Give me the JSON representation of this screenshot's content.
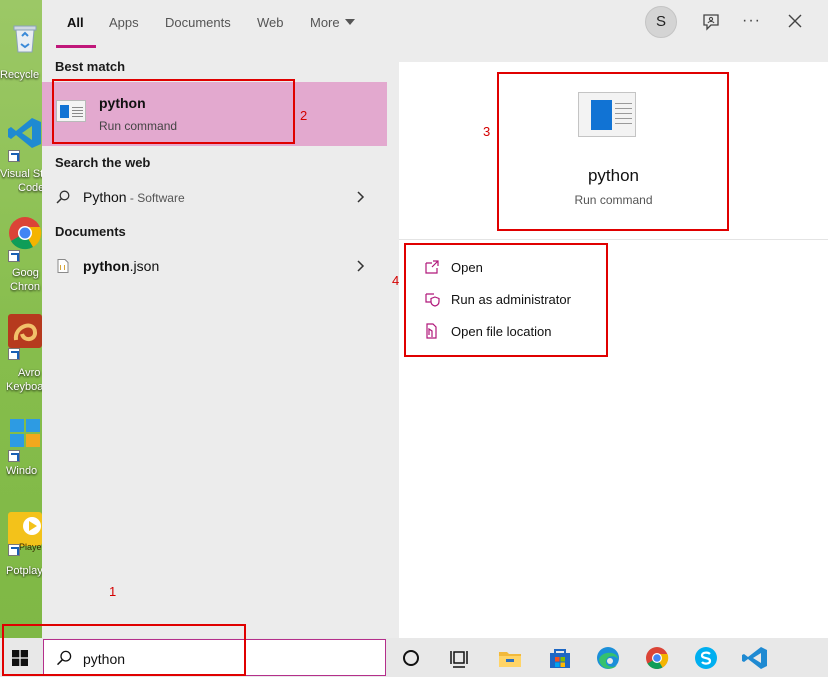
{
  "desktop": {
    "icons": [
      {
        "label": "Recycle",
        "icon": "recycle-bin-icon"
      },
      {
        "label": "Visual St",
        "label2": "Code",
        "icon": "vscode-icon"
      },
      {
        "label": "Goog",
        "label2": "Chron",
        "icon": "chrome-icon"
      },
      {
        "label": "Avro",
        "label2": "Keyboa",
        "icon": "avro-keyboard-icon"
      },
      {
        "label": "Windo",
        "icon": "windows-icon"
      },
      {
        "label": "Potplay",
        "badge": "Playe",
        "icon": "potplayer-icon"
      }
    ]
  },
  "tabs": [
    {
      "label": "All",
      "active": true
    },
    {
      "label": "Apps"
    },
    {
      "label": "Documents"
    },
    {
      "label": "Web"
    },
    {
      "label": "More"
    }
  ],
  "header": {
    "avatar_letter": "S",
    "more_glyph": "···"
  },
  "results": {
    "best_match_heading": "Best match",
    "best_match": {
      "title": "python",
      "subtitle": "Run command",
      "icon": "run-command-icon"
    },
    "web_heading": "Search the web",
    "web_item": {
      "main": "Python",
      "suffix": " - Software",
      "icon": "search-icon"
    },
    "documents_heading": "Documents",
    "document_item": {
      "name_bold": "python",
      "name_rest": ".json",
      "icon": "document-icon"
    }
  },
  "preview": {
    "title": "python",
    "subtitle": "Run command",
    "actions": [
      {
        "label": "Open",
        "icon": "open-icon"
      },
      {
        "label": "Run as administrator",
        "icon": "shield-icon"
      },
      {
        "label": "Open file location",
        "icon": "folder-location-icon"
      }
    ]
  },
  "taskbar": {
    "search_value": "python",
    "pinned": [
      "cortana-icon",
      "task-view-icon",
      "file-explorer-icon",
      "microsoft-store-icon",
      "edge-icon",
      "chrome-icon",
      "skype-icon",
      "vscode-icon"
    ]
  },
  "annotations": [
    "1",
    "2",
    "3",
    "4"
  ],
  "colors": {
    "accent": "#c0177a",
    "best_match_bg": "#e3a9cf",
    "annotation": "#e00000"
  }
}
